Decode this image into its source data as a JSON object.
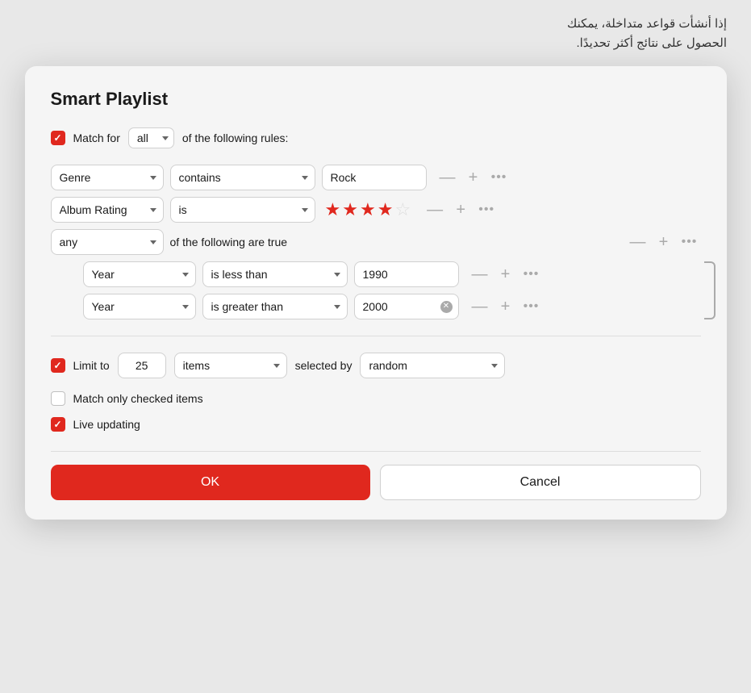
{
  "tooltip": {
    "line1": "إذا أنشأت قواعد متداخلة، يمكنك",
    "line2": "الحصول على نتائج أكثر تحديدًا."
  },
  "dialog": {
    "title": "Smart Playlist",
    "match_label_pre": "Match for",
    "match_value": "all",
    "match_label_post": "of the following rules:",
    "rules": [
      {
        "field": "Genre",
        "condition": "contains",
        "value": "Rock"
      },
      {
        "field": "Album Rating",
        "condition": "is",
        "stars": 3.5
      }
    ],
    "nested": {
      "combinator": "any",
      "combinator_suffix": "of the following are true",
      "sub_rules": [
        {
          "field": "Year",
          "condition": "is less than",
          "value": "1990"
        },
        {
          "field": "Year",
          "condition": "is greater than",
          "value": "2000"
        }
      ]
    },
    "limit": {
      "enabled": true,
      "checkbox_label": "Limit to",
      "value": "25",
      "unit": "items",
      "selected_by_label": "selected by",
      "selected_by_value": "random"
    },
    "match_checked": {
      "enabled": false,
      "label": "Match only checked items"
    },
    "live_updating": {
      "enabled": true,
      "label": "Live updating"
    },
    "ok_label": "OK",
    "cancel_label": "Cancel"
  },
  "icons": {
    "minus": "—",
    "plus": "+",
    "more": "···",
    "chevron": "▾"
  }
}
